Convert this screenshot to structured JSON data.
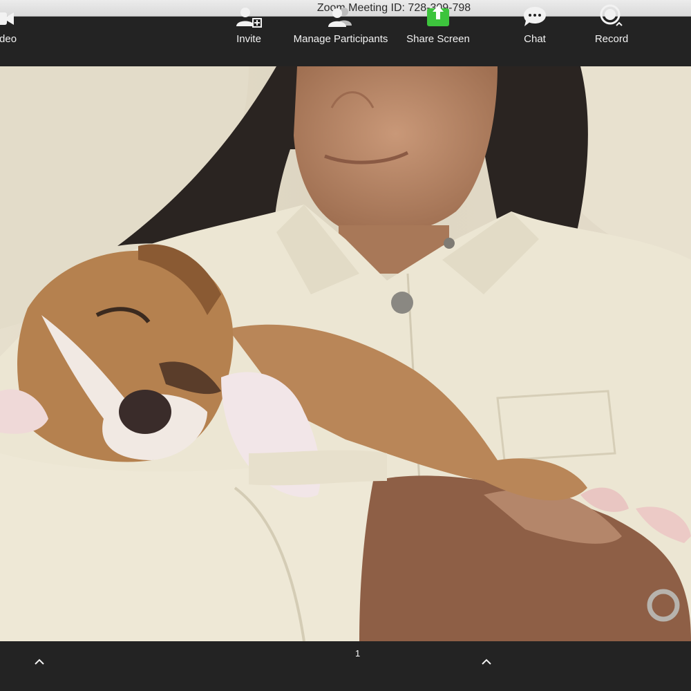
{
  "window": {
    "title": "Zoom Meeting ID: 728-309-798"
  },
  "toolbar": {
    "video_label": "Video",
    "invite_label": "Invite",
    "manage_participants_label": "Manage Participants",
    "participants_count": "1",
    "share_screen_label": "Share Screen",
    "chat_label": "Chat",
    "record_label": "Record"
  },
  "icons": {
    "video": "video-camera-icon",
    "invite": "add-person-icon",
    "participants": "people-icon",
    "share": "share-arrow-icon",
    "chat": "speech-bubble-icon",
    "record": "record-circle-icon",
    "caret": "chevron-up-icon"
  },
  "colors": {
    "toolbar_bg": "#232323",
    "share_green": "#3dc43d",
    "label_text": "#f2f2f2"
  }
}
